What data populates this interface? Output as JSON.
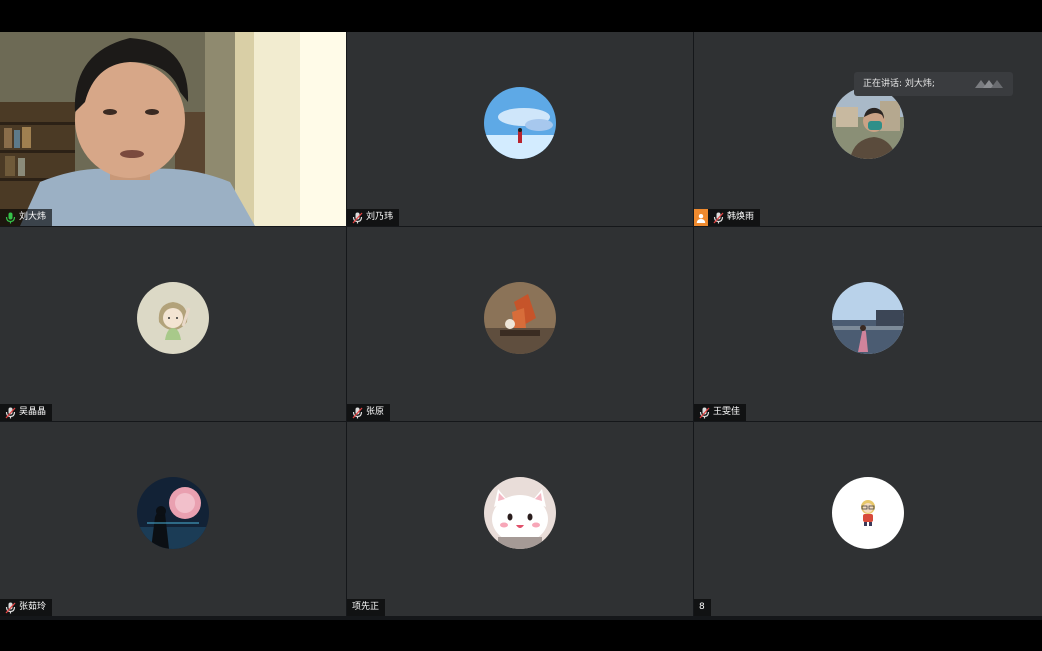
{
  "speaking_toast": "正在讲话: 刘大炜;",
  "participants": [
    {
      "name": "刘大炜",
      "mic": "active"
    },
    {
      "name": "刘乃玮",
      "mic": "muted"
    },
    {
      "name": "韩焕雨",
      "mic": "muted",
      "badge": "host"
    },
    {
      "name": "吴晶晶",
      "mic": "muted"
    },
    {
      "name": "张原",
      "mic": "muted"
    },
    {
      "name": "王雯佳",
      "mic": "muted"
    },
    {
      "name": "张茹玲",
      "mic": "muted"
    },
    {
      "name": "项先正",
      "mic": "none"
    },
    {
      "name": "8",
      "mic": "none"
    }
  ],
  "colors": {
    "active_border": "#36c24a",
    "tile_bg": "#2f3133",
    "host_badge": "#ef8a2e"
  }
}
